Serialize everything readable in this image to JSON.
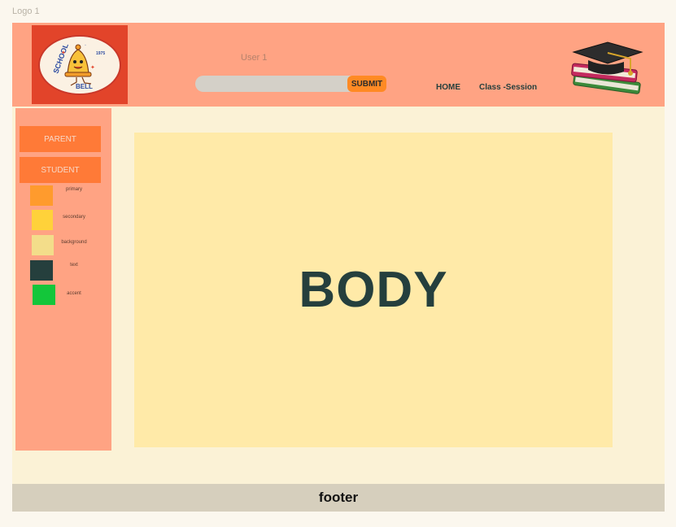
{
  "canvas": {
    "label": "Logo 1"
  },
  "header": {
    "logo": {
      "name": "School Bell",
      "top_text": "SCHOOL",
      "bottom_text": "BELL",
      "year": "1975"
    },
    "user_label": "User 1",
    "search": {
      "value": "",
      "placeholder": ""
    },
    "submit_label": "SUBMIT",
    "nav": {
      "home": "HOME",
      "class_session": "Class -Session"
    }
  },
  "sidebar": {
    "buttons": {
      "parent": "PARENT",
      "student": "STUDENT"
    },
    "palette": [
      {
        "label": "primary",
        "color": "#ff9b2d"
      },
      {
        "label": "secondary",
        "color": "#ffd23a"
      },
      {
        "label": "background",
        "color": "#f3dd8a"
      },
      {
        "label": "text",
        "color": "#253f3d"
      },
      {
        "label": "accent",
        "color": "#13c63a"
      }
    ]
  },
  "main": {
    "title": "BODY"
  },
  "footer": {
    "text": "footer"
  },
  "colors": {
    "header_bg": "#ffa383",
    "button_orange": "#ff7a37",
    "body_bg": "#ffeaa8",
    "frame_bg": "#fbf2d6",
    "footer_bg": "#d6cfbd"
  }
}
